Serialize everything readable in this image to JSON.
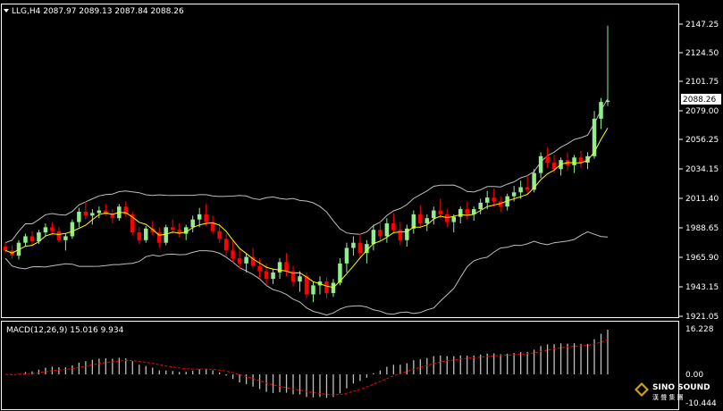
{
  "header": {
    "symbol_line": "LLG,H4  2087.97 2089.13 2087.84 2088.26",
    "indicator_label": "MACD(12,26,9) 15.016 9.934"
  },
  "price_axis": {
    "ticks": [
      "2147.25",
      "2124.50",
      "2101.75",
      "2079.00",
      "2056.25",
      "2034.15",
      "2011.40",
      "1988.65",
      "1965.90",
      "1943.15",
      "1921.05"
    ],
    "current_price_label": "2088.26"
  },
  "macd_axis": {
    "ticks": [
      "16.228",
      "0.00",
      "-10.444"
    ]
  },
  "watermark": {
    "text": "SINO SOUND",
    "subtext": "漢 聲 集 團"
  },
  "colors": {
    "background": "#000000",
    "bull_candle": "#90EE90",
    "bear_candle": "#FF0000",
    "moving_average": "#FFFF00",
    "bollinger": "#BEBEBE",
    "macd_hist": "#C0C0C0",
    "macd_signal": "#FF0000",
    "axis_line": "#FFFFFF"
  },
  "chart_data": {
    "type": "candlestick",
    "y_range": [
      1921.05,
      2147.25
    ],
    "ohlc_approx": [
      [
        1975,
        1978,
        1970,
        1972
      ],
      [
        1972,
        1976,
        1966,
        1968
      ],
      [
        1968,
        1980,
        1965,
        1978
      ],
      [
        1978,
        1985,
        1975,
        1983
      ],
      [
        1983,
        1987,
        1976,
        1979
      ],
      [
        1979,
        1988,
        1977,
        1986
      ],
      [
        1986,
        1993,
        1983,
        1990
      ],
      [
        1990,
        1994,
        1984,
        1987
      ],
      [
        1987,
        1990,
        1978,
        1980
      ],
      [
        1980,
        1985,
        1972,
        1983
      ],
      [
        1983,
        1996,
        1981,
        1994
      ],
      [
        1994,
        2005,
        1990,
        2002
      ],
      [
        2002,
        2010,
        1996,
        1999
      ],
      [
        1999,
        2004,
        1992,
        2001
      ],
      [
        2001,
        2006,
        1997,
        2003
      ],
      [
        2003,
        2008,
        1999,
        2000
      ],
      [
        2000,
        2004,
        1993,
        1997
      ],
      [
        1997,
        2008,
        1995,
        2006
      ],
      [
        2006,
        2010,
        1998,
        2000
      ],
      [
        2000,
        2002,
        1984,
        1986
      ],
      [
        1986,
        1990,
        1977,
        1980
      ],
      [
        1980,
        1991,
        1978,
        1989
      ],
      [
        1989,
        1995,
        1984,
        1986
      ],
      [
        1986,
        1990,
        1974,
        1978
      ],
      [
        1978,
        1992,
        1976,
        1990
      ],
      [
        1990,
        1996,
        1985,
        1988
      ],
      [
        1988,
        1993,
        1982,
        1985
      ],
      [
        1985,
        1992,
        1980,
        1990
      ],
      [
        1990,
        1999,
        1986,
        1996
      ],
      [
        1996,
        2005,
        1990,
        2000
      ],
      [
        2000,
        2008,
        1991,
        1994
      ],
      [
        1994,
        1999,
        1985,
        1987
      ],
      [
        1987,
        1993,
        1978,
        1981
      ],
      [
        1981,
        1985,
        1968,
        1972
      ],
      [
        1972,
        1980,
        1963,
        1966
      ],
      [
        1966,
        1974,
        1958,
        1962
      ],
      [
        1962,
        1970,
        1955,
        1967
      ],
      [
        1967,
        1974,
        1958,
        1960
      ],
      [
        1960,
        1966,
        1950,
        1956
      ],
      [
        1956,
        1962,
        1945,
        1950
      ],
      [
        1950,
        1958,
        1946,
        1955
      ],
      [
        1955,
        1966,
        1950,
        1963
      ],
      [
        1963,
        1970,
        1952,
        1956
      ],
      [
        1956,
        1960,
        1944,
        1948
      ],
      [
        1948,
        1956,
        1940,
        1952
      ],
      [
        1952,
        1955,
        1935,
        1938
      ],
      [
        1938,
        1948,
        1932,
        1945
      ],
      [
        1945,
        1952,
        1938,
        1948
      ],
      [
        1948,
        1951,
        1935,
        1939
      ],
      [
        1939,
        1950,
        1936,
        1947
      ],
      [
        1947,
        1966,
        1945,
        1962
      ],
      [
        1962,
        1978,
        1955,
        1974
      ],
      [
        1974,
        1983,
        1968,
        1978
      ],
      [
        1978,
        1985,
        1966,
        1970
      ],
      [
        1970,
        1980,
        1962,
        1977
      ],
      [
        1977,
        1992,
        1972,
        1988
      ],
      [
        1988,
        1995,
        1979,
        1983
      ],
      [
        1983,
        1997,
        1978,
        1993
      ],
      [
        1993,
        2001,
        1985,
        1988
      ],
      [
        1988,
        1994,
        1976,
        1980
      ],
      [
        1980,
        1992,
        1975,
        1989
      ],
      [
        1989,
        2003,
        1985,
        2000
      ],
      [
        2000,
        2007,
        1990,
        1993
      ],
      [
        1993,
        2000,
        1987,
        1997
      ],
      [
        1997,
        2006,
        1992,
        2003
      ],
      [
        2003,
        2012,
        1997,
        2000
      ],
      [
        2000,
        2004,
        1990,
        1994
      ],
      [
        1994,
        2000,
        1986,
        1998
      ],
      [
        1998,
        2006,
        1993,
        2004
      ],
      [
        2004,
        2010,
        1996,
        2000
      ],
      [
        2000,
        2006,
        1995,
        2004
      ],
      [
        2004,
        2012,
        2000,
        2009
      ],
      [
        2009,
        2018,
        2004,
        2013
      ],
      [
        2013,
        2020,
        2006,
        2010
      ],
      [
        2010,
        2014,
        2002,
        2006
      ],
      [
        2006,
        2016,
        2003,
        2014
      ],
      [
        2014,
        2022,
        2010,
        2017
      ],
      [
        2017,
        2026,
        2012,
        2021
      ],
      [
        2021,
        2030,
        2016,
        2019
      ],
      [
        2019,
        2035,
        2017,
        2032
      ],
      [
        2032,
        2048,
        2028,
        2045
      ],
      [
        2045,
        2052,
        2036,
        2040
      ],
      [
        2040,
        2046,
        2032,
        2035
      ],
      [
        2035,
        2044,
        2030,
        2042
      ],
      [
        2042,
        2048,
        2034,
        2038
      ],
      [
        2038,
        2046,
        2032,
        2044
      ],
      [
        2044,
        2049,
        2036,
        2040
      ],
      [
        2040,
        2048,
        2035,
        2045
      ],
      [
        2045,
        2080,
        2043,
        2074
      ],
      [
        2074,
        2090,
        2066,
        2087
      ],
      [
        2087,
        2146,
        2084,
        2088
      ]
    ]
  }
}
